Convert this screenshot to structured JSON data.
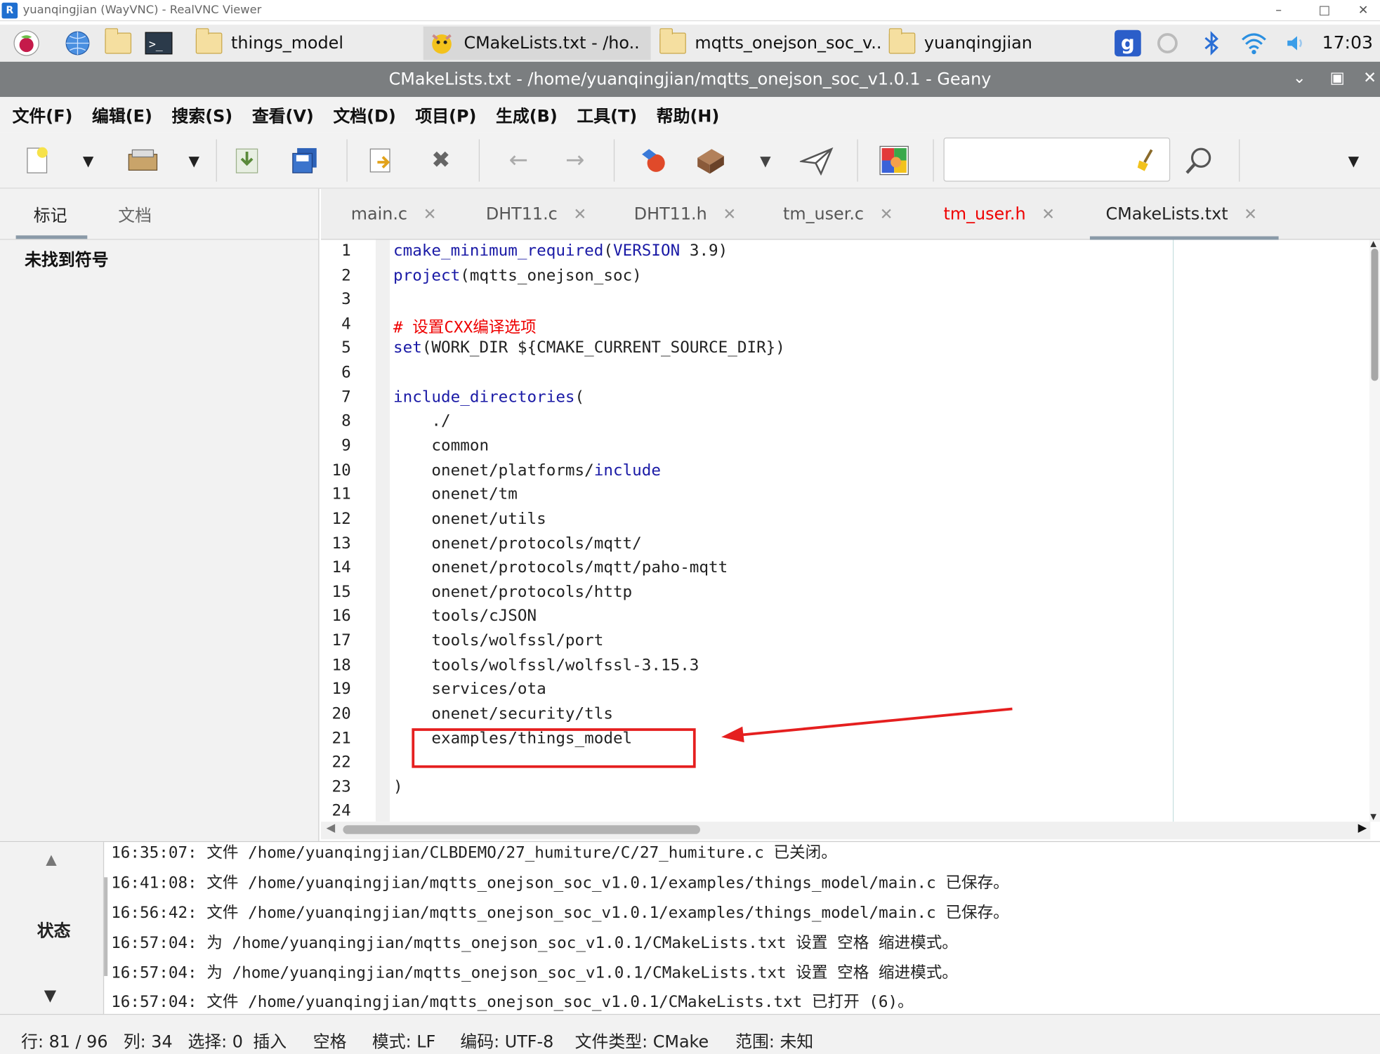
{
  "vnc": {
    "title": "yuanqingjian (WayVNC) - RealVNC Viewer",
    "logo": "R"
  },
  "taskbar": {
    "tasks": [
      {
        "label": "things_model"
      },
      {
        "label": "CMakeLists.txt - /ho.."
      },
      {
        "label": "mqtts_onejson_soc_v.."
      },
      {
        "label": "yuanqingjian"
      }
    ],
    "clock": "17:03"
  },
  "window": {
    "title": "CMakeLists.txt - /home/yuanqingjian/mqtts_onejson_soc_v1.0.1 - Geany"
  },
  "menu": [
    "文件(F)",
    "编辑(E)",
    "搜索(S)",
    "查看(V)",
    "文档(D)",
    "项目(P)",
    "生成(B)",
    "工具(T)",
    "帮助(H)"
  ],
  "search": {
    "value": ""
  },
  "sidebar": {
    "tabs": [
      "标记",
      "文档"
    ],
    "empty_text": "未找到符号"
  },
  "editor_tabs": [
    "main.c",
    "DHT11.c",
    "DHT11.h",
    "tm_user.c",
    "tm_user.h",
    "CMakeLists.txt"
  ],
  "code": {
    "line_numbers": [
      "1",
      "2",
      "3",
      "4",
      "5",
      "6",
      "7",
      "8",
      "9",
      "10",
      "11",
      "12",
      "13",
      "14",
      "15",
      "16",
      "17",
      "18",
      "19",
      "20",
      "21",
      "22",
      "23",
      "24"
    ],
    "l1_kw": "cmake_minimum_required",
    "l1_a": "(",
    "l1_kw2": "VERSION",
    "l1_b": " 3.9)",
    "l2_kw": "project",
    "l2_rest": "(mqtts_onejson_soc)",
    "l4_comment": "# 设置CXX编译选项",
    "l5_kw": "set",
    "l5_rest": "(WORK_DIR ${CMAKE_CURRENT_SOURCE_DIR})",
    "l7_kw": "include_directories",
    "l7_rest": "(",
    "l8": "    ./",
    "l9": "    common",
    "l10_a": "    onenet/platforms/",
    "l10_kw": "include",
    "l11": "    onenet/tm",
    "l12": "    onenet/utils",
    "l13": "    onenet/protocols/mqtt/",
    "l14": "    onenet/protocols/mqtt/paho-mqtt",
    "l15": "    onenet/protocols/http",
    "l16": "    tools/cJSON",
    "l17": "    tools/wolfssl/port",
    "l18": "    tools/wolfssl/wolfssl-3.15.3",
    "l19": "    services/ota",
    "l20": "    onenet/security/tls",
    "l21": "    examples/things_model",
    "l23": ")"
  },
  "messages": {
    "label": "状态",
    "lines": [
      "16:35:07: 文件 /home/yuanqingjian/CLBDEMO/27_humiture/C/27_humiture.c 已关闭。",
      "16:41:08: 文件 /home/yuanqingjian/mqtts_onejson_soc_v1.0.1/examples/things_model/main.c 已保存。",
      "16:56:42: 文件 /home/yuanqingjian/mqtts_onejson_soc_v1.0.1/examples/things_model/main.c 已保存。",
      "16:57:04: 为 /home/yuanqingjian/mqtts_onejson_soc_v1.0.1/CMakeLists.txt 设置 空格 缩进模式。",
      "16:57:04: 为 /home/yuanqingjian/mqtts_onejson_soc_v1.0.1/CMakeLists.txt 设置 空格 缩进模式。",
      "16:57:04: 文件 /home/yuanqingjian/mqtts_onejson_soc_v1.0.1/CMakeLists.txt 已打开 (6)。"
    ]
  },
  "status": {
    "line": "行: 81 / 96",
    "col": "列: 34",
    "sel": "选择: 0",
    "mode_ins": "插入",
    "indent": "空格",
    "eol": "模式: LF",
    "enc": "编码: UTF-8",
    "ftype": "文件类型: CMake",
    "scope": "范围: 未知"
  },
  "colors": {
    "accent_red": "#e51f1f",
    "keyword": "#1a1aa6",
    "title_bar": "#7b7e80"
  }
}
